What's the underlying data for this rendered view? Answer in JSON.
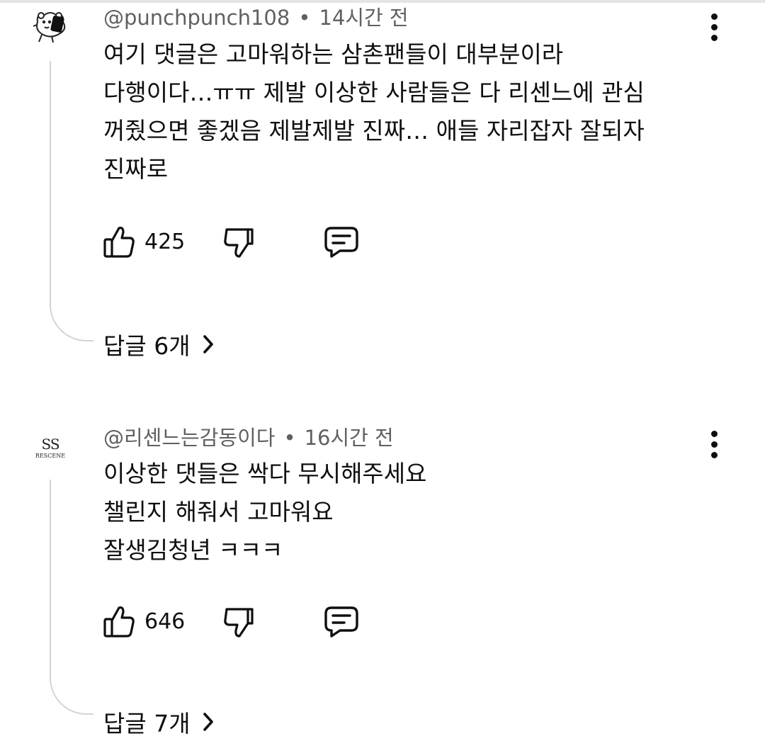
{
  "comments": [
    {
      "author": "@punchpunch108",
      "time": "14시간 전",
      "lines": [
        "여기 댓글은 고마워하는 삼촌팬들이 대부분이라",
        "다행이다…ㅠㅠ 제발 이상한 사람들은 다 리센느에 관심",
        "꺼줬으면 좋겠음 제발제발 진짜… 애들 자리잡자 잘되자",
        "진짜로"
      ],
      "likes": "425",
      "replies_label": "답글 6개",
      "avatar_icon": "cartoon-character-avatar"
    },
    {
      "author": "@리센느는감동이다",
      "time": "16시간 전",
      "lines": [
        "이상한 댓들은 싹다 무시해주세요",
        "챌린지 해줘서 고마워요",
        "잘생김청년 ㅋㅋㅋ"
      ],
      "likes": "646",
      "replies_label": "답글 7개",
      "avatar_icon": "rescene-logo-avatar",
      "avatar_text": {
        "mark": "SS",
        "name": "RESCENE"
      }
    }
  ],
  "icons": {
    "like": "thumbs-up-icon",
    "dislike": "thumbs-down-icon",
    "reply": "comment-bubble-icon",
    "more": "more-vertical-icon",
    "chevron": "chevron-right-icon"
  },
  "colors": {
    "text": "#0f0f0f",
    "meta": "#606060",
    "thread": "#d4d4d4"
  }
}
